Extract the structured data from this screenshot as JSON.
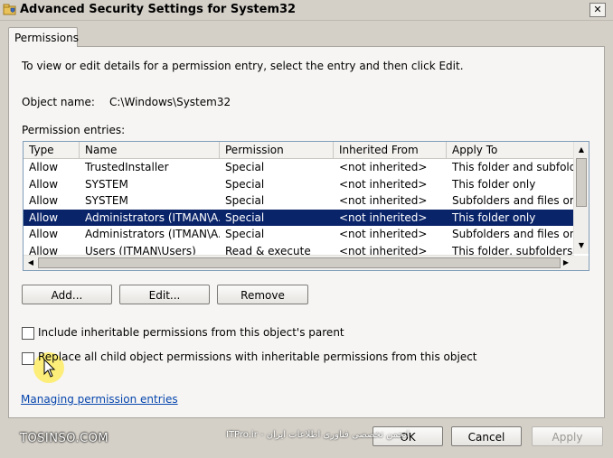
{
  "window": {
    "title": "Advanced Security Settings for System32",
    "close_glyph": "✕"
  },
  "tabs": [
    {
      "label": "Permissions"
    }
  ],
  "main": {
    "description": "To view or edit details for a permission entry, select the entry and then click Edit.",
    "object_name_label": "Object name:",
    "object_name_value": "C:\\Windows\\System32",
    "entries_label": "Permission entries:"
  },
  "table": {
    "columns": [
      "Type",
      "Name",
      "Permission",
      "Inherited From",
      "Apply To"
    ],
    "rows": [
      {
        "type": "Allow",
        "name": "TrustedInstaller",
        "permission": "Special",
        "inherited": "<not inherited>",
        "apply": "This folder and subfolders",
        "selected": false
      },
      {
        "type": "Allow",
        "name": "SYSTEM",
        "permission": "Special",
        "inherited": "<not inherited>",
        "apply": "This folder only",
        "selected": false
      },
      {
        "type": "Allow",
        "name": "SYSTEM",
        "permission": "Special",
        "inherited": "<not inherited>",
        "apply": "Subfolders and files only",
        "selected": false
      },
      {
        "type": "Allow",
        "name": "Administrators (ITMAN\\A...",
        "permission": "Special",
        "inherited": "<not inherited>",
        "apply": "This folder only",
        "selected": true
      },
      {
        "type": "Allow",
        "name": "Administrators (ITMAN\\A...",
        "permission": "Special",
        "inherited": "<not inherited>",
        "apply": "Subfolders and files only",
        "selected": false
      },
      {
        "type": "Allow",
        "name": "Users (ITMAN\\Users)",
        "permission": "Read & execute",
        "inherited": "<not inherited>",
        "apply": "This folder, subfolders a...",
        "selected": false
      }
    ]
  },
  "buttons": {
    "add": "Add...",
    "edit": "Edit...",
    "remove": "Remove",
    "ok": "OK",
    "cancel": "Cancel",
    "apply": "Apply"
  },
  "checkboxes": {
    "include_inheritable": {
      "label": "Include inheritable permissions from this object's parent",
      "checked": false
    },
    "replace_child": {
      "label": "Replace all child object permissions with inheritable permissions from this object",
      "checked": false
    }
  },
  "link": "Managing permission entries",
  "watermarks": {
    "left": "TOSINSO.COM",
    "middle": "ITPro.ir - انجمن تخصصی فناوری اطلاعات ایران"
  },
  "icons": {
    "app": "folder-shield-icon",
    "scroll_up": "▲",
    "scroll_down": "▼",
    "scroll_left": "◀",
    "scroll_right": "▶"
  },
  "colors": {
    "selection": "#0a246a",
    "link": "#0645ad",
    "dialog_bg": "#d4d0c8"
  }
}
